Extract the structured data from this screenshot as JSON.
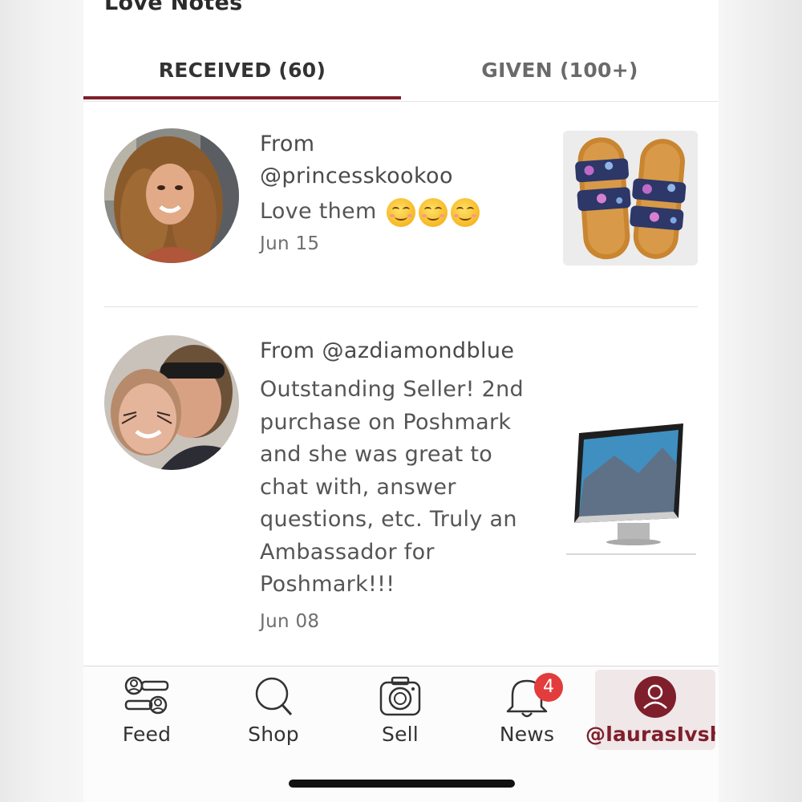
{
  "header": {
    "title": "Love Notes"
  },
  "tabs": [
    {
      "label": "RECEIVED (60)",
      "active": true
    },
    {
      "label": "GIVEN (100+)",
      "active": false
    }
  ],
  "notes": [
    {
      "from_line1": "From",
      "from_line2": "@princesskookoo",
      "message": "Love them",
      "emoji": [
        "smiling-face-icon",
        "smiling-face-icon",
        "smiling-face-icon"
      ],
      "date": "Jun 15",
      "product_icon": "sandals-product-image"
    },
    {
      "from": "From @azdiamondblue",
      "message_lines": [
        "Outstanding Seller! 2nd",
        "purchase on Poshmark",
        "and she was great to",
        "chat with, answer",
        "questions, etc. Truly an",
        "Ambassador for",
        "Poshmark!!!"
      ],
      "date": "Jun 08",
      "product_icon": "imac-product-image"
    }
  ],
  "bottom_nav": {
    "items": [
      {
        "label": "Feed",
        "icon": "feed-icon"
      },
      {
        "label": "Shop",
        "icon": "search-icon"
      },
      {
        "label": "Sell",
        "icon": "camera-icon"
      },
      {
        "label": "News",
        "icon": "bell-icon",
        "badge": "4"
      },
      {
        "label": "@laurasIvshop",
        "icon": "profile-icon",
        "active": true
      }
    ]
  },
  "colors": {
    "accent": "#7f1f2b",
    "badge": "#e23c3c",
    "text": "#4a4a4a"
  }
}
